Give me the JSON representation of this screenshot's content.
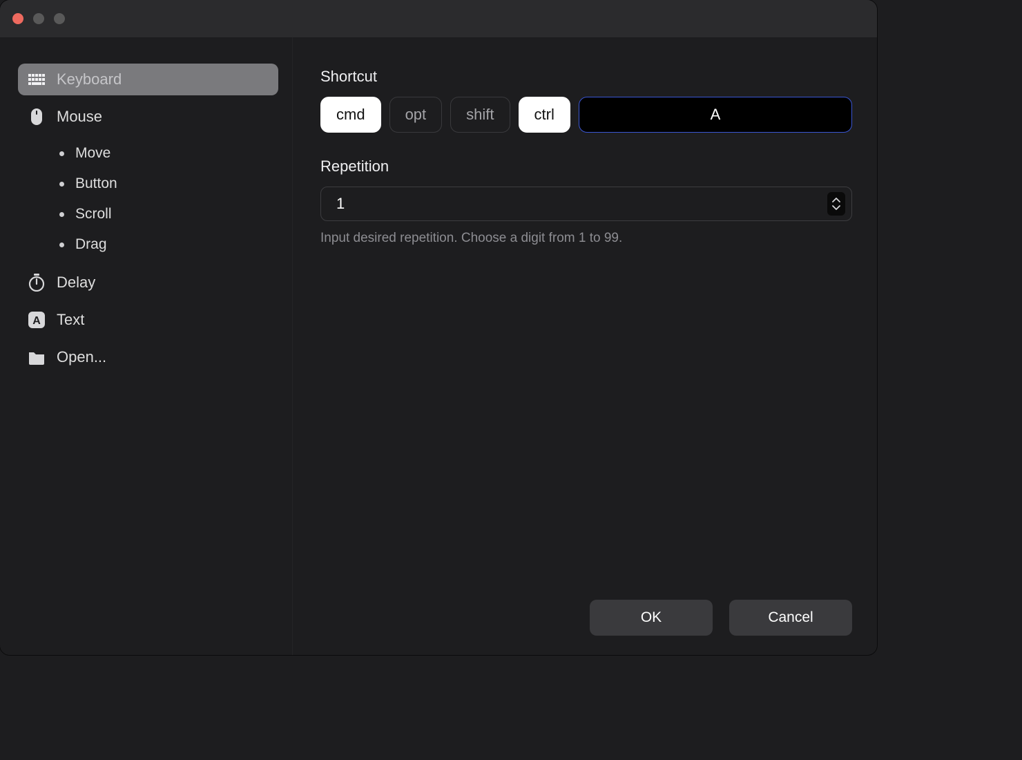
{
  "sidebar": {
    "items": [
      {
        "label": "Keyboard",
        "icon": "keyboard-icon"
      },
      {
        "label": "Mouse",
        "icon": "mouse-icon"
      },
      {
        "label": "Delay",
        "icon": "stopwatch-icon"
      },
      {
        "label": "Text",
        "icon": "text-letter-icon"
      },
      {
        "label": "Open...",
        "icon": "folder-icon"
      }
    ],
    "mouse_subitems": [
      {
        "label": "Move"
      },
      {
        "label": "Button"
      },
      {
        "label": "Scroll"
      },
      {
        "label": "Drag"
      }
    ]
  },
  "main": {
    "shortcut_label": "Shortcut",
    "mods": {
      "cmd": {
        "label": "cmd",
        "on": true
      },
      "opt": {
        "label": "opt",
        "on": false
      },
      "shift": {
        "label": "shift",
        "on": false
      },
      "ctrl": {
        "label": "ctrl",
        "on": true
      }
    },
    "key_value": "A",
    "repetition_label": "Repetition",
    "repetition_value": "1",
    "repetition_hint": "Input desired repetition. Choose a digit from 1 to 99."
  },
  "footer": {
    "ok_label": "OK",
    "cancel_label": "Cancel"
  }
}
